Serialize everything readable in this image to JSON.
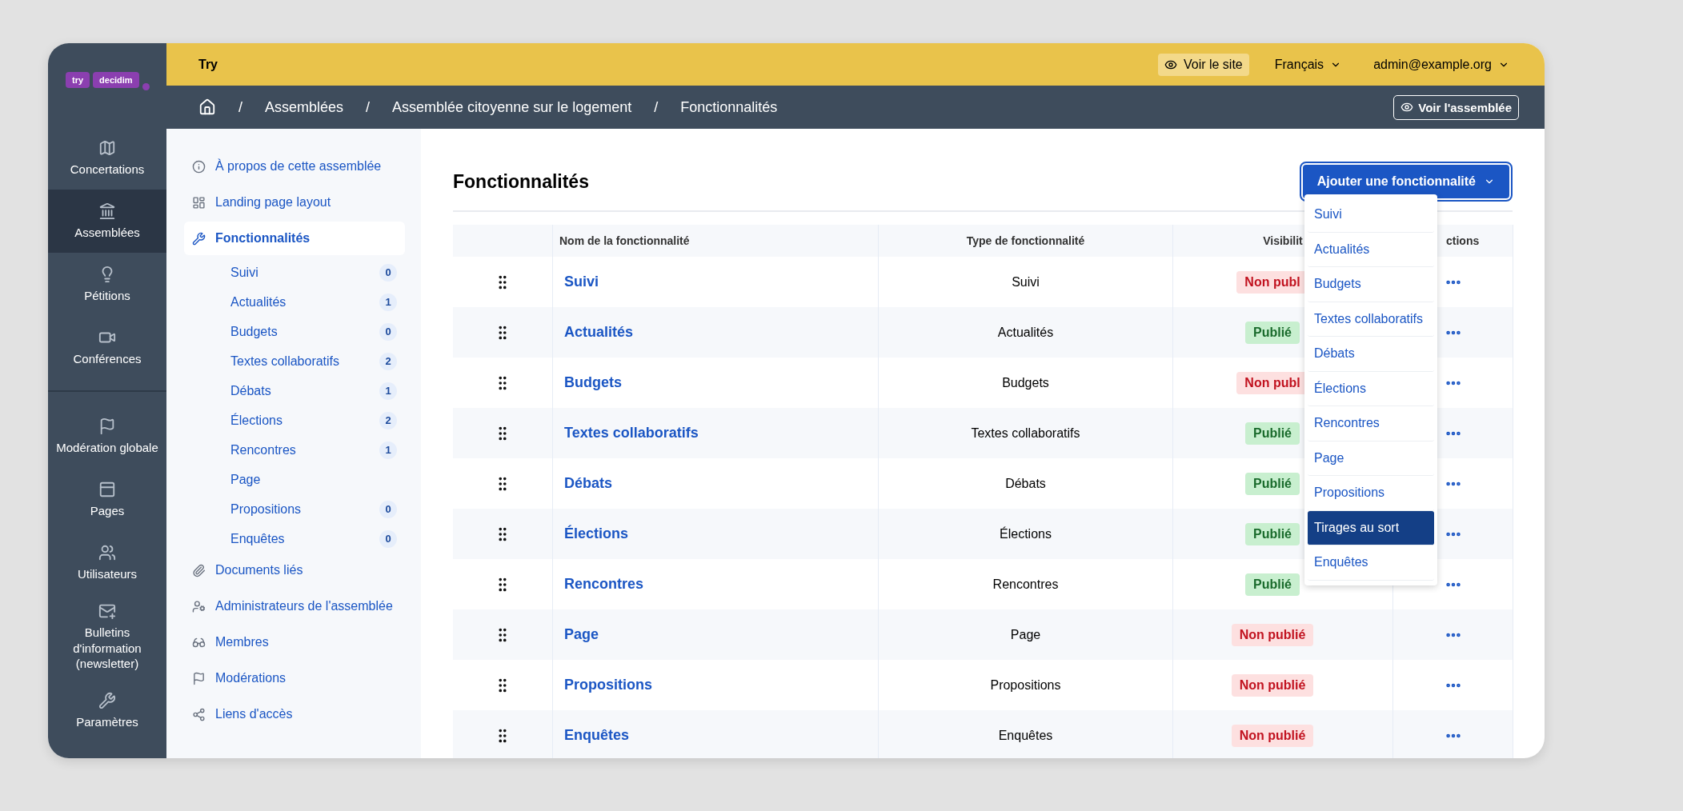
{
  "logo": [
    "try",
    "decidim"
  ],
  "topbar": {
    "title": "Try",
    "view_site": "Voir le site",
    "language": "Français",
    "user": "admin@example.org"
  },
  "breadcrumb": [
    {
      "separator": "/",
      "label": "Assemblées"
    },
    {
      "separator": "/",
      "label": "Assemblée citoyenne sur le logement"
    },
    {
      "separator": "/",
      "label": "Fonctionnalités"
    }
  ],
  "view_assembly": "Voir l'assemblée",
  "main_nav_top": [
    {
      "label": "Concertations",
      "selected": false
    },
    {
      "label": "Assemblées",
      "selected": true
    },
    {
      "label": "Pétitions",
      "selected": false
    },
    {
      "label": "Conférences",
      "selected": false
    }
  ],
  "main_nav_bottom": [
    {
      "label": "Modération globale",
      "selected": false
    },
    {
      "label": "Pages",
      "selected": false
    },
    {
      "label": "Utilisateurs",
      "selected": false
    },
    {
      "label": "Bulletins d'information (newsletter)",
      "selected": false
    },
    {
      "label": "Paramètres",
      "selected": false
    }
  ],
  "sub_nav": [
    {
      "label": "À propos de cette assemblée",
      "selected": false
    },
    {
      "label": "Landing page layout",
      "selected": false
    },
    {
      "label": "Fonctionnalités",
      "selected": true,
      "children": [
        {
          "label": "Suivi",
          "count": "0"
        },
        {
          "label": "Actualités",
          "count": "1"
        },
        {
          "label": "Budgets",
          "count": "0"
        },
        {
          "label": "Textes collaboratifs",
          "count": "2"
        },
        {
          "label": "Débats",
          "count": "1"
        },
        {
          "label": "Élections",
          "count": "2"
        },
        {
          "label": "Rencontres",
          "count": "1"
        },
        {
          "label": "Page"
        },
        {
          "label": "Propositions",
          "count": "0"
        },
        {
          "label": "Enquêtes",
          "count": "0"
        }
      ]
    },
    {
      "label": "Documents liés",
      "selected": false
    },
    {
      "label": "Administrateurs de l'assemblée",
      "selected": false
    },
    {
      "label": "Membres",
      "selected": false
    },
    {
      "label": "Modérations",
      "selected": false
    },
    {
      "label": "Liens d'accès",
      "selected": false
    }
  ],
  "content": {
    "title": "Fonctionnalités",
    "add_button": "Ajouter une fonctionnalité",
    "columns": [
      "Nom de la fonctionnalité",
      "Type de fonctionnalité",
      "Visibilit",
      "ctions"
    ],
    "rows": [
      {
        "name": "Suivi",
        "type": "Suivi",
        "visibility": "Non publ",
        "published": false
      },
      {
        "name": "Actualités",
        "type": "Actualités",
        "visibility": "Publié",
        "published": true
      },
      {
        "name": "Budgets",
        "type": "Budgets",
        "visibility": "Non publ",
        "published": false
      },
      {
        "name": "Textes collaboratifs",
        "type": "Textes collaboratifs",
        "visibility": "Publié",
        "published": true
      },
      {
        "name": "Débats",
        "type": "Débats",
        "visibility": "Publié",
        "published": true
      },
      {
        "name": "Élections",
        "type": "Élections",
        "visibility": "Publié",
        "published": true
      },
      {
        "name": "Rencontres",
        "type": "Rencontres",
        "visibility": "Publié",
        "published": true
      },
      {
        "name": "Page",
        "type": "Page",
        "visibility": "Non publié",
        "published": false
      },
      {
        "name": "Propositions",
        "type": "Propositions",
        "visibility": "Non publié",
        "published": false
      },
      {
        "name": "Enquêtes",
        "type": "Enquêtes",
        "visibility": "Non publié",
        "published": false
      }
    ],
    "dropdown": [
      {
        "label": "Suivi",
        "selected": false
      },
      {
        "label": "Actualités",
        "selected": false
      },
      {
        "label": "Budgets",
        "selected": false
      },
      {
        "label": "Textes collaboratifs",
        "selected": false
      },
      {
        "label": "Débats",
        "selected": false
      },
      {
        "label": "Élections",
        "selected": false
      },
      {
        "label": "Rencontres",
        "selected": false
      },
      {
        "label": "Page",
        "selected": false
      },
      {
        "label": "Propositions",
        "selected": false
      },
      {
        "label": "Tirages au sort",
        "selected": true
      },
      {
        "label": "Enquêtes",
        "selected": false
      }
    ]
  }
}
